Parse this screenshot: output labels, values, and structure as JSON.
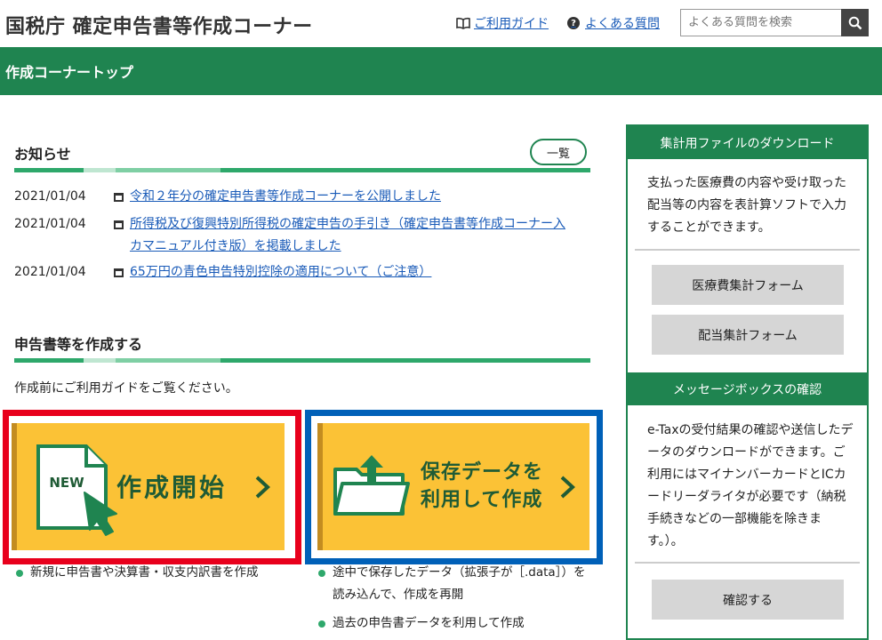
{
  "header": {
    "title": "国税庁 確定申告書等作成コーナー",
    "guide_link": "ご利用ガイド",
    "faq_link": "よくある質問",
    "search_placeholder": "よくある質問を検索"
  },
  "nav": {
    "page_title": "作成コーナートップ"
  },
  "news": {
    "title": "お知らせ",
    "list_button": "一覧",
    "items": [
      {
        "date": "2021/01/04",
        "text": "令和２年分の確定申告書等作成コーナーを公開しました"
      },
      {
        "date": "2021/01/04",
        "text": "所得税及び復興特別所得税の確定申告の手引き（確定申告書等作成コーナー入カマニュアル付き版）を掲載しました"
      },
      {
        "date": "2021/01/04",
        "text": "65万円の青色申告特別控除の適用について（ご注意）"
      }
    ]
  },
  "create": {
    "title": "申告書等を作成する",
    "intro": "作成前にご利用ガイドをご覧ください。",
    "start_card": {
      "badge": "NEW",
      "label": "作成開始"
    },
    "saved_card": {
      "label_line1": "保存データを",
      "label_line2": "利用して作成"
    },
    "start_bullets": [
      "新規に申告書や決算書・収支内訳書を作成"
    ],
    "saved_bullets": [
      "途中で保存したデータ（拡張子が［.data］）を読み込んで、作成を再開",
      "過去の申告書データを利用して作成"
    ]
  },
  "sidebar": {
    "download": {
      "heading": "集計用ファイルのダウンロード",
      "text": "支払った医療費の内容や受け取った配当等の内容を表計算ソフトで入力することができます。",
      "buttons": [
        "医療費集計フォーム",
        "配当集計フォーム"
      ]
    },
    "messagebox": {
      "heading": "メッセージボックスの確認",
      "text": "e-Taxの受付結果の確認や送信したデータのダウンロードができます。ご利用にはマイナンバーカードとICカードリーダライタが必要です（納税手続きなどの一部機能を除きます。）。",
      "button": "確認する"
    }
  },
  "colors": {
    "brand_green": "#1f8450",
    "card_yellow": "#fbc236",
    "highlight_red": "#e8001c",
    "highlight_blue": "#0060b8"
  }
}
